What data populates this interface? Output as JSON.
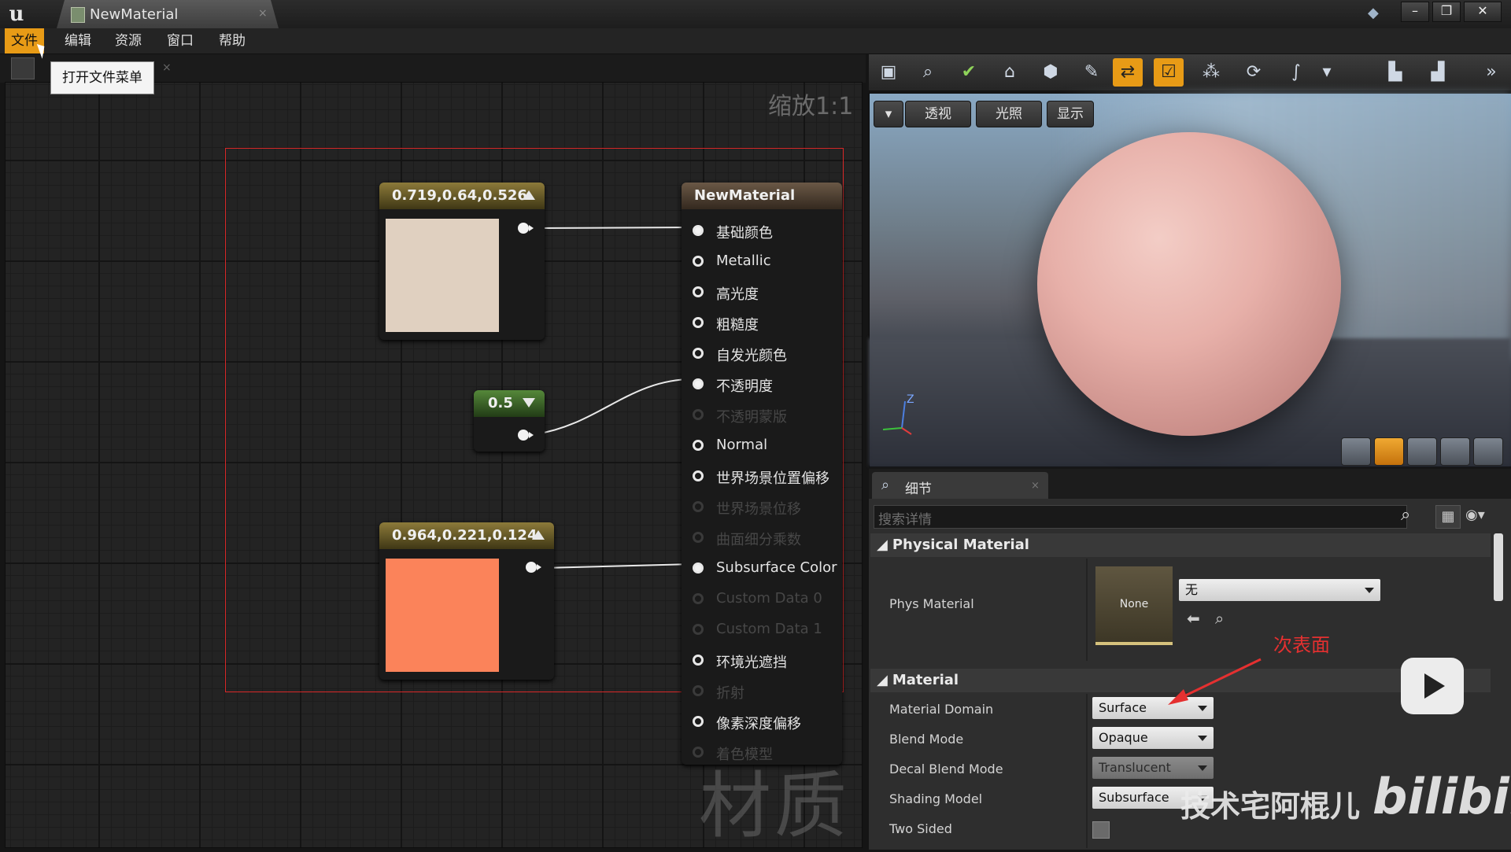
{
  "title_bar": {
    "tab_label": "NewMaterial",
    "tab_close": "×",
    "window_buttons": {
      "minimize": "–",
      "restore": "❐",
      "close": "✕"
    },
    "icons": {
      "logo": "unreal-logo",
      "pin": "pin-icon"
    }
  },
  "menu": {
    "items": [
      "文件",
      "编辑",
      "资源",
      "窗口",
      "帮助"
    ],
    "active_index": 0,
    "tooltip": "打开文件菜单"
  },
  "graph": {
    "zoom_label": "缩放1:1",
    "watermark": "材质",
    "tab_close": "×",
    "nodes": {
      "constant3_a": {
        "value_label": "0.719,0.64,0.526",
        "color": "#e0d0c0"
      },
      "constant": {
        "value_label": "0.5"
      },
      "constant3_b": {
        "value_label": "0.964,0.221,0.124",
        "color": "#fb835a"
      }
    },
    "material_node": {
      "title": "NewMaterial",
      "inputs": [
        {
          "label": "基础颜色",
          "connected": true,
          "enabled": true
        },
        {
          "label": "Metallic",
          "connected": false,
          "enabled": true
        },
        {
          "label": "高光度",
          "connected": false,
          "enabled": true
        },
        {
          "label": "粗糙度",
          "connected": false,
          "enabled": true
        },
        {
          "label": "自发光颜色",
          "connected": false,
          "enabled": true
        },
        {
          "label": "不透明度",
          "connected": true,
          "enabled": true
        },
        {
          "label": "不透明蒙版",
          "connected": false,
          "enabled": false
        },
        {
          "label": "Normal",
          "connected": false,
          "enabled": true
        },
        {
          "label": "世界场景位置偏移",
          "connected": false,
          "enabled": true
        },
        {
          "label": "世界场景位移",
          "connected": false,
          "enabled": false
        },
        {
          "label": "曲面细分乘数",
          "connected": false,
          "enabled": false
        },
        {
          "label": "Subsurface Color",
          "connected": true,
          "enabled": true
        },
        {
          "label": "Custom Data 0",
          "connected": false,
          "enabled": false
        },
        {
          "label": "Custom Data 1",
          "connected": false,
          "enabled": false
        },
        {
          "label": "环境光遮挡",
          "connected": false,
          "enabled": true
        },
        {
          "label": "折射",
          "connected": false,
          "enabled": false
        },
        {
          "label": "像素深度偏移",
          "connected": false,
          "enabled": true
        },
        {
          "label": "着色模型",
          "connected": false,
          "enabled": false
        }
      ]
    }
  },
  "toolbar": {
    "icons": [
      "save-icon",
      "find-icon",
      "apply-check-icon",
      "home-icon",
      "hierarchy-icon",
      "clean-up-icon",
      "connectors-icon",
      "live-preview-icon",
      "live-nodes-icon",
      "live-update-icon",
      "hlsl-icon",
      "dropdown-icon",
      "stats-icon",
      "platform-stats-icon",
      "more-icon"
    ],
    "active": [
      "connectors-icon",
      "live-preview-icon"
    ]
  },
  "viewport": {
    "buttons": {
      "perspective": "透视",
      "lit": "光照",
      "show": "显示"
    },
    "axis_label": "Z",
    "preview_shapes": [
      "cylinder-icon",
      "sphere-icon",
      "plane-icon",
      "cube-icon",
      "custom-mesh-icon"
    ],
    "active_shape": "sphere-icon"
  },
  "details": {
    "tab_label": "细节",
    "tab_close": "×",
    "search_placeholder": "搜索详情",
    "categories": {
      "physical": {
        "title": "Physical Material",
        "phys_label": "Phys Material",
        "thumb_text": "None",
        "dropdown_value": "无"
      },
      "material": {
        "title": "Material",
        "rows": [
          {
            "label": "Material Domain",
            "value": "Surface"
          },
          {
            "label": "Blend Mode",
            "value": "Opaque"
          },
          {
            "label": "Decal Blend Mode",
            "value": "Translucent"
          },
          {
            "label": "Shading Model",
            "value": "Subsurface"
          },
          {
            "label": "Two Sided",
            "value": ""
          }
        ]
      }
    }
  },
  "annotation": {
    "text": "次表面",
    "color": "#e53030"
  },
  "watermark": {
    "uploader": "技术宅阿棍儿",
    "site": "bilibili"
  }
}
